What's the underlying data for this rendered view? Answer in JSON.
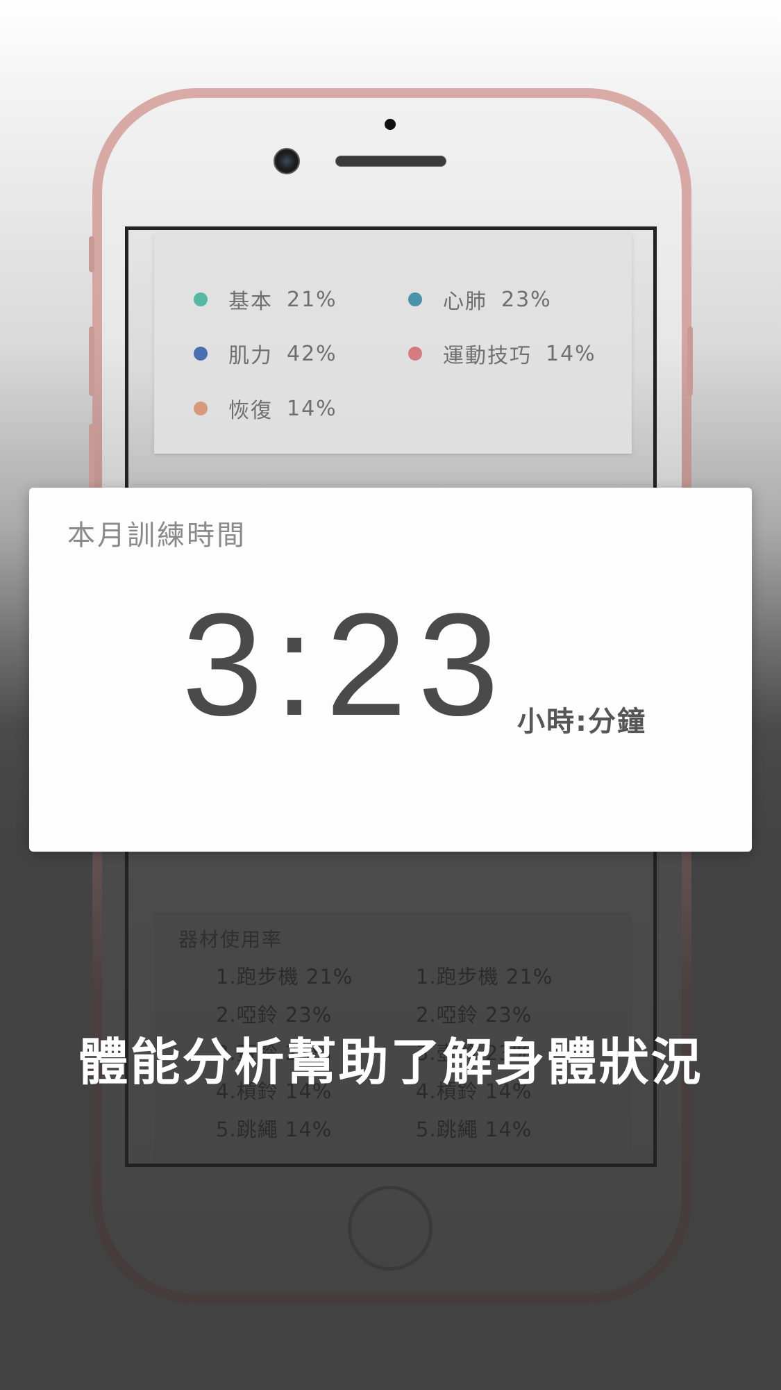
{
  "breakdown": {
    "items": [
      {
        "label": "基本",
        "value": "21%",
        "color": "#55b8a0"
      },
      {
        "label": "心肺",
        "value": "23%",
        "color": "#4a93aa"
      },
      {
        "label": "肌力",
        "value": "42%",
        "color": "#4a6fb0"
      },
      {
        "label": "運動技巧",
        "value": "14%",
        "color": "#d67a80"
      },
      {
        "label": "恢復",
        "value": "14%",
        "color": "#d99a7c"
      }
    ]
  },
  "training_time": {
    "title": "本月訓練時間",
    "value": "3:23",
    "unit": "小時:分鐘"
  },
  "equipment": {
    "title": "器材使用率",
    "columns": [
      [
        "1.跑步機   21%",
        "2.啞鈴   23%",
        "3.壺鈴   23%",
        "4.槓鈴  14%",
        "5.跳繩   14%"
      ],
      [
        "1.跑步機   21%",
        "2.啞鈴   23%",
        "3.壺鈴   23%",
        "4.槓鈴  14%",
        "5.跳繩   14%"
      ]
    ]
  },
  "caption": "體能分析幫助了解身體狀況"
}
